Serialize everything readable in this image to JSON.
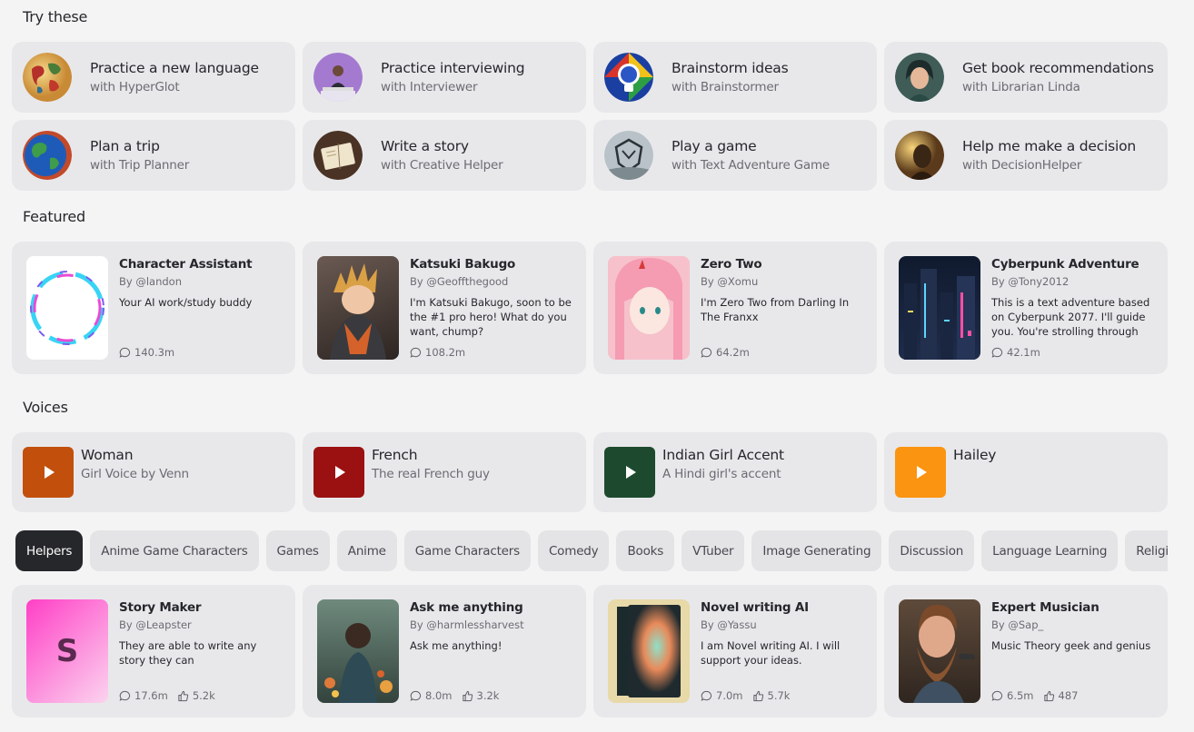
{
  "sections": {
    "try_these": "Try these",
    "featured": "Featured",
    "voices": "Voices"
  },
  "try_these": [
    {
      "title": "Practice a new language",
      "sub": "with HyperGlot",
      "icon": "world-map-globe-icon"
    },
    {
      "title": "Practice interviewing",
      "sub": "with Interviewer",
      "icon": "interviewer-avatar"
    },
    {
      "title": "Brainstorm ideas",
      "sub": "with Brainstormer",
      "icon": "lightbulb-icon"
    },
    {
      "title": "Get book recommendations",
      "sub": "with Librarian Linda",
      "icon": "librarian-avatar"
    },
    {
      "title": "Plan a trip",
      "sub": "with Trip Planner",
      "icon": "earth-globe-icon"
    },
    {
      "title": "Write a story",
      "sub": "with Creative Helper",
      "icon": "notebook-icon"
    },
    {
      "title": "Play a game",
      "sub": "with Text Adventure Game",
      "icon": "game-emblem-icon"
    },
    {
      "title": "Help me make a decision",
      "sub": "with DecisionHelper",
      "icon": "decision-avatar"
    }
  ],
  "featured": [
    {
      "name": "Character Assistant",
      "by": "By @landon",
      "desc": "Your AI work/study buddy",
      "chats": "140.3m"
    },
    {
      "name": "Katsuki Bakugo",
      "by": "By @Geoffthegood",
      "desc": "I'm Katsuki Bakugo, soon to be the #1 pro hero! What do you want, chump?",
      "chats": "108.2m"
    },
    {
      "name": "Zero Two",
      "by": "By @Xomu",
      "desc": "I'm Zero Two from Darling In The Franxx",
      "chats": "64.2m"
    },
    {
      "name": "Cyberpunk Adventure",
      "by": "By @Tony2012",
      "desc": "This is a text adventure based on Cyberpunk 2077. I'll guide you. You're strolling through a…",
      "chats": "42.1m"
    }
  ],
  "voices": [
    {
      "name": "Woman",
      "sub": "Girl Voice by Venn",
      "color": "#c2500c"
    },
    {
      "name": "French",
      "sub": "The real French guy",
      "color": "#9b1111"
    },
    {
      "name": "Indian Girl Accent",
      "sub": "A Hindi girl's accent",
      "color": "#1d4a2e"
    },
    {
      "name": "Hailey",
      "sub": "",
      "color": "#fb9410"
    }
  ],
  "tabs": [
    "Helpers",
    "Anime Game Characters",
    "Games",
    "Anime",
    "Game Characters",
    "Comedy",
    "Books",
    "VTuber",
    "Image Generating",
    "Discussion",
    "Language Learning",
    "Religion"
  ],
  "helpers": [
    {
      "name": "Story Maker",
      "by": "By @Leapster",
      "desc": "They are able to write any story they can",
      "chats": "17.6m",
      "likes": "5.2k",
      "initial": "S"
    },
    {
      "name": "Ask me anything",
      "by": "By @harmlessharvest",
      "desc": "Ask me anything!",
      "chats": "8.0m",
      "likes": "3.2k"
    },
    {
      "name": "Novel writing AI",
      "by": "By @Yassu",
      "desc": "I am Novel writing AI. I will support your ideas.",
      "chats": "7.0m",
      "likes": "5.7k"
    },
    {
      "name": "Expert Musician",
      "by": "By @Sap_",
      "desc": "Music Theory geek and genius",
      "chats": "6.5m",
      "likes": "487"
    }
  ]
}
